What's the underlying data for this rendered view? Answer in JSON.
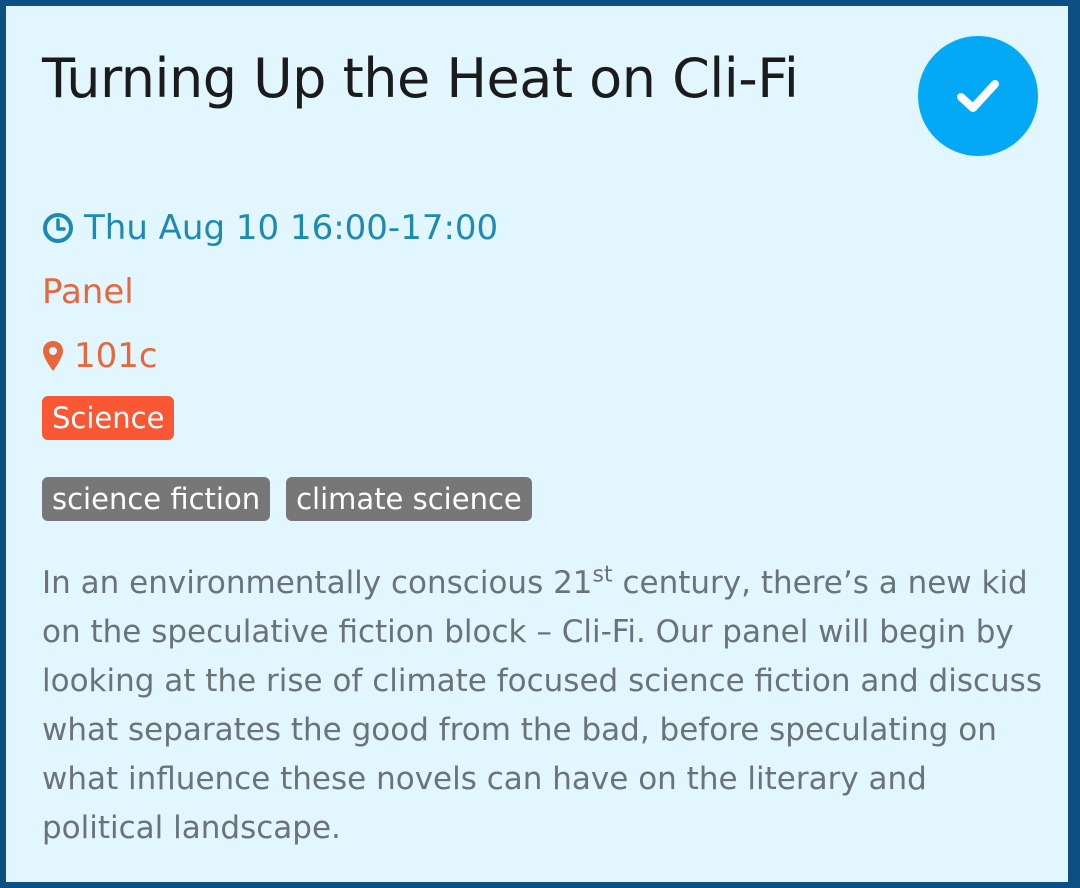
{
  "event": {
    "title": "Turning Up the Heat on Cli-Fi",
    "time": "Thu Aug 10 16:00-17:00",
    "type": "Panel",
    "room": "101c",
    "track": "Science",
    "tags": [
      "science fiction",
      "climate science"
    ],
    "description": {
      "before_sup": "In an environmentally conscious 21",
      "sup": "st",
      "after_sup": " century, there’s a new kid on the speculative fiction block – Cli-Fi. Our panel will begin by looking at the rise of climate focused science fiction and discuss what separates the good from the bad, before speculating on what influence these novels can have on the literary and political landscape."
    },
    "starred": true
  },
  "icons": {
    "star_button": "check-icon",
    "time": "clock-icon",
    "room": "map-marker-icon"
  },
  "colors": {
    "page_border": "#0d4f82",
    "card_background": "#e1f6fe",
    "title": "#1b1b1b",
    "star_button": "#03a9f4",
    "time": "#1d8ab5",
    "type": "#e8673c",
    "room": "#e8673c",
    "track_badge": "#fa5734",
    "tag_badge": "#777777",
    "description": "#6b7378"
  }
}
